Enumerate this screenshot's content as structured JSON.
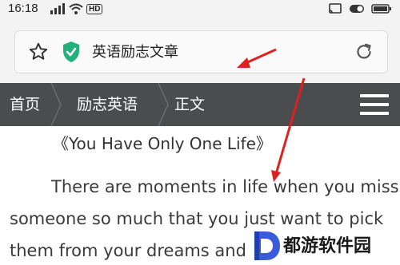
{
  "status_bar": {
    "time": "16:18",
    "signal_label": "4G",
    "hd_label": "HD"
  },
  "address_bar": {
    "text": "英语励志文章",
    "shield_color": "#22b07d"
  },
  "nav": {
    "items": [
      {
        "label": "首页"
      },
      {
        "label": "励志英语"
      },
      {
        "label": "正文"
      }
    ]
  },
  "article": {
    "title": "《You Have Only One Life》",
    "lines": [
      "There are moments in life when you miss",
      "someone so much that you just want to pick",
      "them from your dreams and"
    ]
  },
  "watermark": {
    "text": "都游软件园",
    "logo_color": "#3a5bd9"
  },
  "annotation": {
    "arrow_color": "#e02020"
  }
}
